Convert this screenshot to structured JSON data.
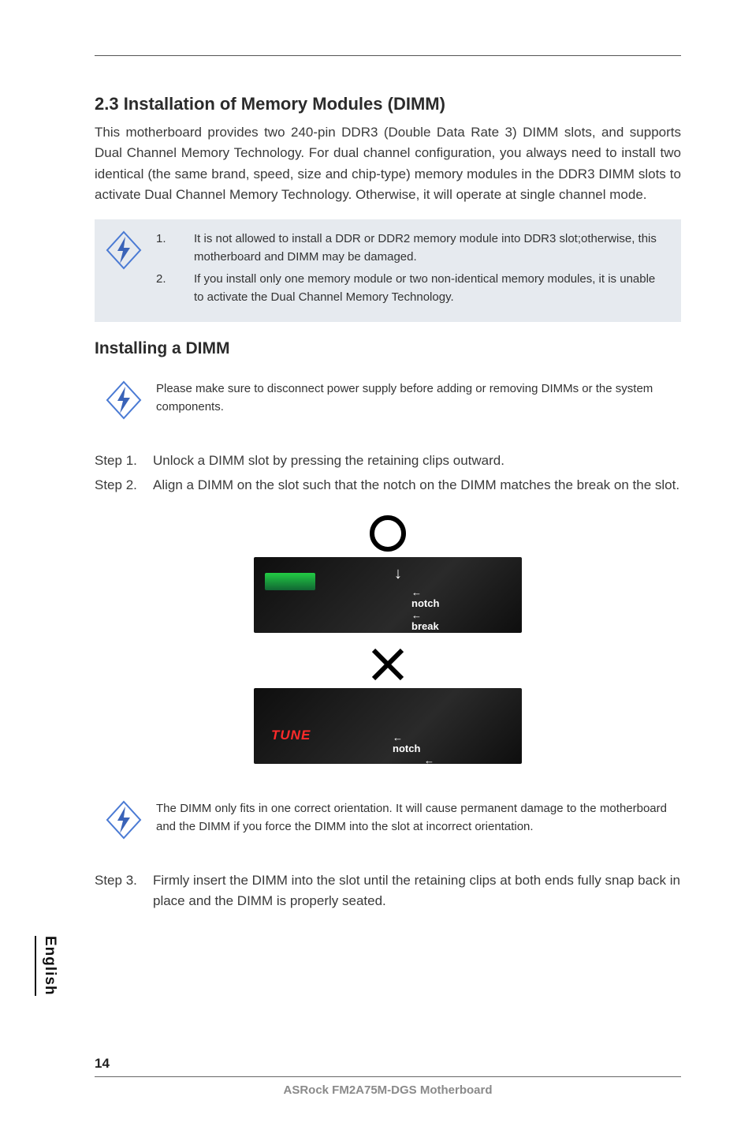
{
  "section": {
    "title": "2.3  Installation of Memory Modules (DIMM)",
    "intro": "This motherboard provides two 240-pin DDR3 (Double Data Rate 3) DIMM slots, and supports Dual Channel Memory Technology. For dual channel configuration, you always need to install two identical (the same brand, speed, size and chip-type) memory modules in the DDR3 DIMM slots to activate Dual Channel Memory Technology. Otherwise, it will operate at single channel mode."
  },
  "warnings": {
    "items": [
      {
        "num": "1.",
        "text": "It is not allowed to install a DDR or DDR2 memory module into DDR3 slot;otherwise, this motherboard and DIMM may be damaged."
      },
      {
        "num": "2.",
        "text": "If you install only one memory module or two non-identical memory modules, it is unable to activate the Dual Channel Memory Technology."
      }
    ]
  },
  "installing": {
    "title": "Installing a DIMM",
    "precaution": "Please make sure to disconnect power supply before adding or removing DIMMs or the system components.",
    "steps": [
      {
        "label": "Step 1.",
        "text": "Unlock a DIMM slot by pressing the retaining clips outward."
      },
      {
        "label": "Step 2.",
        "text": "Align a DIMM on the slot such that the notch on the DIMM matches the break on the slot."
      }
    ],
    "fig_labels": {
      "notch": "notch",
      "break": "break"
    },
    "orientation_note": "The DIMM only fits in one correct orientation. It will cause permanent damage to the motherboard and the DIMM if you force the DIMM into the slot at incorrect orientation.",
    "step3": {
      "label": "Step 3.",
      "text": "Firmly insert the DIMM into the slot until the retaining clips at both ends fully snap back in place and the DIMM is properly seated."
    }
  },
  "side_tab": "English",
  "footer": "ASRock  FM2A75M-DGS  Motherboard",
  "page_number": "14"
}
